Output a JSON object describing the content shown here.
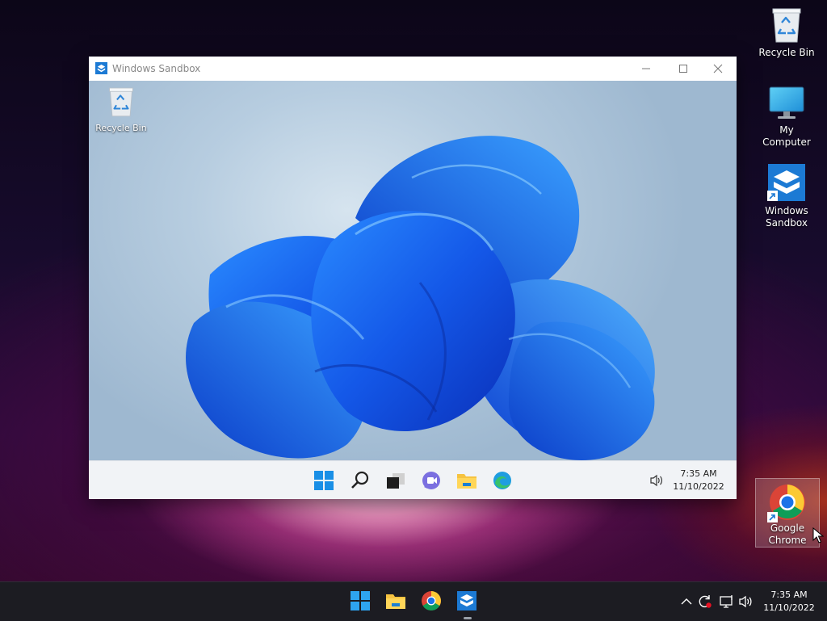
{
  "desktop": {
    "icons": [
      {
        "label": "Recycle Bin",
        "icon": "recycle-bin-icon"
      },
      {
        "label": "My Computer",
        "icon": "monitor-icon"
      },
      {
        "label": "Windows Sandbox",
        "icon": "windows-sandbox-icon",
        "shortcut": true
      },
      {
        "label": "Google Chrome",
        "icon": "chrome-icon",
        "shortcut": true,
        "selected": true
      }
    ]
  },
  "sandbox_window": {
    "title": "Windows Sandbox",
    "controls": [
      "minimize",
      "maximize",
      "close"
    ],
    "inner_desktop": {
      "icons": [
        {
          "label": "Recycle Bin",
          "icon": "recycle-bin-icon"
        }
      ],
      "wallpaper": "windows-11-bloom",
      "taskbar": {
        "apps": [
          "start-icon",
          "search-icon",
          "task-view-icon",
          "chat-icon",
          "file-explorer-icon",
          "edge-icon"
        ],
        "tray": [
          "volume-icon"
        ],
        "time": "7:35 AM",
        "date": "11/10/2022"
      }
    }
  },
  "taskbar": {
    "apps": [
      {
        "name": "Start",
        "icon": "start-icon"
      },
      {
        "name": "File Explorer",
        "icon": "file-explorer-icon"
      },
      {
        "name": "Google Chrome",
        "icon": "chrome-icon"
      },
      {
        "name": "Windows Sandbox",
        "icon": "windows-sandbox-icon",
        "running": true
      }
    ],
    "tray": [
      "chevron-up-icon",
      "update-icon",
      "network-icon",
      "volume-icon"
    ],
    "time": "7:35 AM",
    "date": "11/10/2022"
  },
  "colors": {
    "accent": "#0078d4",
    "sandbox_blue": "#1c7ad4",
    "taskbar": "#1c1c22",
    "window_bg": "#ffffff",
    "inner_taskbar": "#f1f3f6"
  }
}
